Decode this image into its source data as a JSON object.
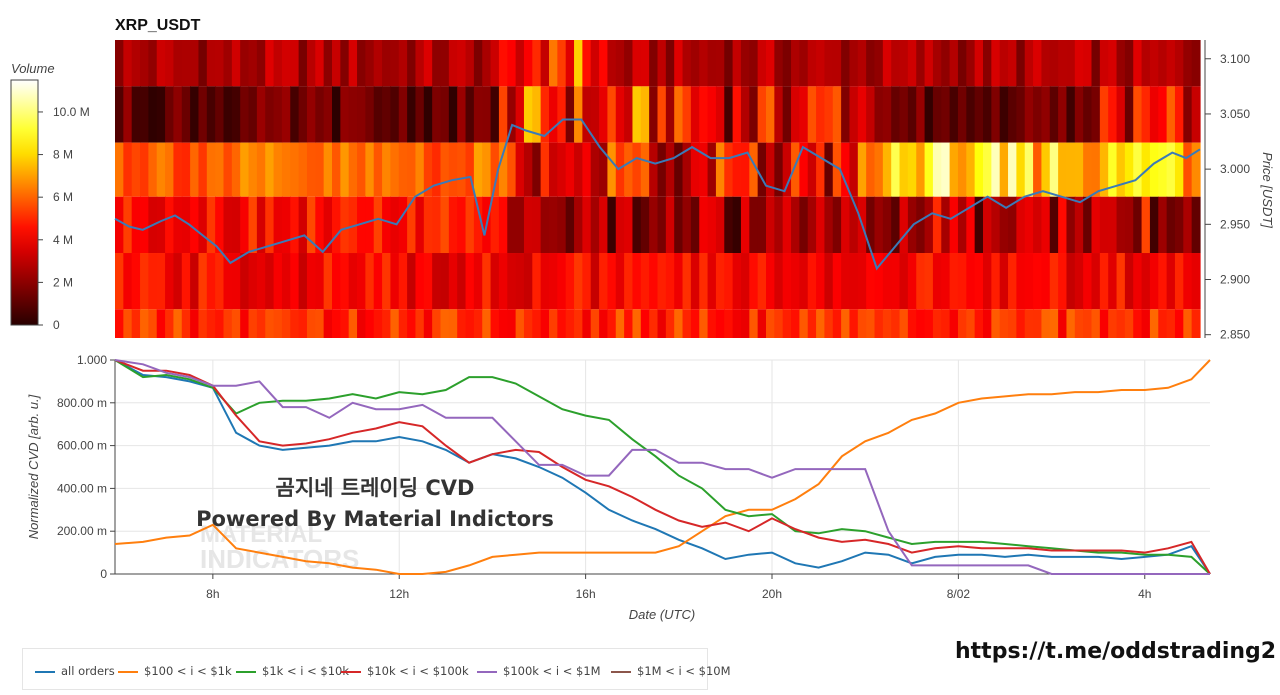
{
  "header": {
    "title": "XRP_USDT"
  },
  "footer": {
    "link": "https://t.me/oddstrading2"
  },
  "watermark": {
    "line1": "곰지네 트레이딩 CVD",
    "line2": "Powered By Material Indictors",
    "logo_text_1": "MATERIAL",
    "logo_text_2": "INDICATORS"
  },
  "colors": {
    "all_orders": "#1f77b4",
    "s100_1k": "#ff7f0e",
    "s1k_10k": "#2ca02c",
    "s10k_100k": "#d62728",
    "s100k_1m": "#9467bd",
    "s1m_10m": "#8c564b",
    "price_line": "#3a7ab8"
  },
  "chart_data": [
    {
      "type": "heatmap",
      "title": "XRP_USDT",
      "ylabel": "Price [USDT]",
      "colorbar": {
        "label": "Volume",
        "ticks": [
          "0",
          "2 M",
          "4 M",
          "6 M",
          "8 M",
          "10.0 M"
        ],
        "tick_values": [
          0,
          2,
          4,
          6,
          8,
          10
        ],
        "max": 11.5
      },
      "y_ticks": [
        "2.850",
        "2.900",
        "2.950",
        "3.000",
        "3.050",
        "3.100"
      ],
      "y_tick_values": [
        2.85,
        2.9,
        2.95,
        3.0,
        3.05,
        3.1
      ],
      "ylim": [
        2.847,
        3.117
      ],
      "price_bands": [
        {
          "range": [
            3.075,
            3.117
          ],
          "base": 2.6
        },
        {
          "range": [
            3.024,
            3.075
          ],
          "base": 1.2
        },
        {
          "range": [
            2.975,
            3.024
          ],
          "base": 6.0
        },
        {
          "range": [
            2.924,
            2.975
          ],
          "base": 4.5
        },
        {
          "range": [
            2.873,
            2.924
          ],
          "base": 4.2
        },
        {
          "range": [
            2.847,
            2.873
          ],
          "base": 5.0
        }
      ],
      "price_series": {
        "name": "Price",
        "x_hours": [
          5.9,
          6.2,
          6.5,
          6.9,
          7.2,
          7.5,
          7.8,
          8.1,
          8.4,
          8.8,
          9.2,
          9.6,
          10.0,
          10.4,
          10.8,
          11.2,
          11.6,
          12.0,
          12.4,
          12.8,
          13.2,
          13.6,
          13.9,
          14.2,
          14.5,
          14.8,
          15.2,
          15.6,
          16.0,
          16.4,
          16.8,
          17.2,
          17.6,
          18.0,
          18.4,
          18.8,
          19.2,
          19.6,
          20.0,
          20.4,
          20.8,
          21.2,
          21.6,
          22.0,
          22.4,
          22.8,
          23.2,
          23.6,
          24.0,
          24.4,
          24.8,
          25.2,
          25.6,
          26.0,
          26.4,
          26.8,
          27.2,
          27.6,
          28.0,
          28.4,
          28.8,
          29.1,
          29.4
        ],
        "price": [
          2.955,
          2.948,
          2.945,
          2.953,
          2.958,
          2.95,
          2.94,
          2.93,
          2.915,
          2.925,
          2.93,
          2.935,
          2.94,
          2.925,
          2.945,
          2.95,
          2.955,
          2.95,
          2.975,
          2.985,
          2.99,
          2.993,
          2.94,
          3.0,
          3.04,
          3.035,
          3.03,
          3.045,
          3.045,
          3.02,
          3.0,
          3.01,
          3.005,
          3.01,
          3.02,
          3.01,
          3.01,
          3.015,
          2.985,
          2.98,
          3.02,
          3.01,
          3.0,
          2.96,
          2.91,
          2.93,
          2.95,
          2.96,
          2.955,
          2.965,
          2.975,
          2.965,
          2.975,
          2.98,
          2.975,
          2.97,
          2.98,
          2.985,
          2.99,
          3.005,
          3.015,
          3.01,
          3.018
        ]
      }
    },
    {
      "type": "line",
      "xlabel": "Date (UTC)",
      "ylabel": "Normalized CVD [arb. u.]",
      "x_ticks": [
        "8h",
        "12h",
        "16h",
        "20h",
        "8/02",
        "4h"
      ],
      "x_tick_values": [
        8,
        12,
        16,
        20,
        24,
        28
      ],
      "xlim": [
        5.9,
        29.4
      ],
      "y_ticks": [
        "0",
        "200.00 m",
        "400.00 m",
        "600.00 m",
        "800.00 m",
        "1.000"
      ],
      "y_tick_values": [
        0,
        0.2,
        0.4,
        0.6,
        0.8,
        1.0
      ],
      "ylim": [
        0,
        1.0
      ],
      "x": [
        5.9,
        6.5,
        7.0,
        7.5,
        8.0,
        8.5,
        9.0,
        9.5,
        10.0,
        10.5,
        11.0,
        11.5,
        12.0,
        12.5,
        13.0,
        13.5,
        14.0,
        14.5,
        15.0,
        15.5,
        16.0,
        16.5,
        17.0,
        17.5,
        18.0,
        18.5,
        19.0,
        19.5,
        20.0,
        20.5,
        21.0,
        21.5,
        22.0,
        22.5,
        23.0,
        23.5,
        24.0,
        24.5,
        25.0,
        25.5,
        26.0,
        26.5,
        27.0,
        27.5,
        28.0,
        28.5,
        29.0,
        29.4
      ],
      "series": [
        {
          "name": "all orders",
          "color_key": "all_orders",
          "values": [
            1.0,
            0.93,
            0.92,
            0.9,
            0.87,
            0.66,
            0.6,
            0.58,
            0.59,
            0.6,
            0.62,
            0.62,
            0.64,
            0.62,
            0.58,
            0.52,
            0.56,
            0.54,
            0.5,
            0.45,
            0.38,
            0.3,
            0.25,
            0.21,
            0.16,
            0.12,
            0.07,
            0.09,
            0.1,
            0.05,
            0.03,
            0.06,
            0.1,
            0.09,
            0.05,
            0.08,
            0.09,
            0.09,
            0.08,
            0.09,
            0.08,
            0.08,
            0.08,
            0.07,
            0.08,
            0.09,
            0.13,
            0.0
          ]
        },
        {
          "name": "$100 < i < $1k",
          "color_key": "s100_1k",
          "values": [
            0.14,
            0.15,
            0.17,
            0.18,
            0.23,
            0.12,
            0.1,
            0.08,
            0.06,
            0.05,
            0.03,
            0.02,
            0.0,
            0.0,
            0.01,
            0.04,
            0.08,
            0.09,
            0.1,
            0.1,
            0.1,
            0.1,
            0.1,
            0.1,
            0.13,
            0.2,
            0.27,
            0.3,
            0.3,
            0.35,
            0.42,
            0.55,
            0.62,
            0.66,
            0.72,
            0.75,
            0.8,
            0.82,
            0.83,
            0.84,
            0.84,
            0.85,
            0.85,
            0.86,
            0.86,
            0.87,
            0.91,
            1.0
          ]
        },
        {
          "name": "$1k < i < $10k",
          "color_key": "s1k_10k",
          "values": [
            1.0,
            0.92,
            0.93,
            0.91,
            0.87,
            0.75,
            0.8,
            0.81,
            0.81,
            0.82,
            0.84,
            0.82,
            0.85,
            0.84,
            0.86,
            0.92,
            0.92,
            0.89,
            0.83,
            0.77,
            0.74,
            0.72,
            0.63,
            0.55,
            0.46,
            0.4,
            0.3,
            0.27,
            0.28,
            0.2,
            0.19,
            0.21,
            0.2,
            0.17,
            0.14,
            0.15,
            0.15,
            0.15,
            0.14,
            0.13,
            0.12,
            0.11,
            0.1,
            0.1,
            0.09,
            0.09,
            0.08,
            0.0
          ]
        },
        {
          "name": "$10k < i < $100k",
          "color_key": "s10k_100k",
          "values": [
            1.0,
            0.95,
            0.95,
            0.93,
            0.88,
            0.74,
            0.62,
            0.6,
            0.61,
            0.63,
            0.66,
            0.68,
            0.71,
            0.69,
            0.6,
            0.52,
            0.56,
            0.58,
            0.57,
            0.5,
            0.44,
            0.41,
            0.36,
            0.3,
            0.25,
            0.22,
            0.24,
            0.2,
            0.26,
            0.21,
            0.17,
            0.15,
            0.16,
            0.14,
            0.1,
            0.12,
            0.13,
            0.12,
            0.12,
            0.12,
            0.11,
            0.11,
            0.11,
            0.11,
            0.1,
            0.12,
            0.15,
            0.0
          ]
        },
        {
          "name": "$100k < i < $1M",
          "color_key": "s100k_1m",
          "values": [
            1.0,
            0.98,
            0.94,
            0.92,
            0.88,
            0.88,
            0.9,
            0.78,
            0.78,
            0.73,
            0.8,
            0.77,
            0.77,
            0.79,
            0.73,
            0.73,
            0.73,
            0.62,
            0.51,
            0.51,
            0.46,
            0.46,
            0.58,
            0.58,
            0.52,
            0.52,
            0.49,
            0.49,
            0.45,
            0.49,
            0.49,
            0.49,
            0.49,
            0.2,
            0.04,
            0.04,
            0.04,
            0.04,
            0.04,
            0.04,
            0.0,
            0.0,
            0.0,
            0.0,
            0.0,
            0.0,
            0.0,
            0.0
          ]
        },
        {
          "name": "$1M < i < $10M",
          "color_key": "s1m_10m",
          "values": []
        }
      ]
    }
  ]
}
